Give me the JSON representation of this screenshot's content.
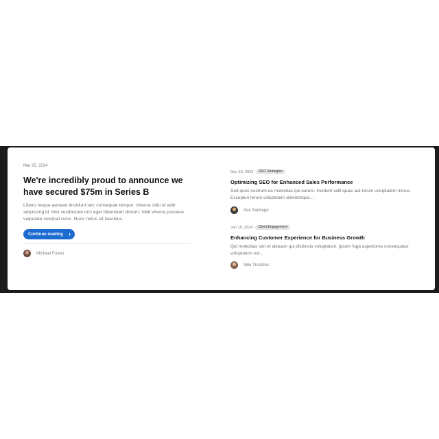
{
  "featured": {
    "date": "Mar 25, 2024",
    "title": "We're incredibly proud to announce we have secured $75m in Series B",
    "excerpt": "Libero neque aenean tincidunt nec consequat tempor. Viverra odio id velit adipiscing id. Nisi vestibulum orci eget bibendum dictum. Velit viverra posuere vulputate volutpat nunc. Nunc netus sit faucibus.",
    "cta_label": "Continue reading",
    "cta_icon": "chevron-right-icon",
    "author": "Michael Foster"
  },
  "posts": [
    {
      "date": "Dec 10, 2023",
      "badge": "SEO Strategies",
      "title": "Optimizing SEO for Enhanced Sales Performance",
      "excerpt": "Sed quos nostrum ea molestias qui earum. Incidunt velit quasi aut rerum voluptatem minus. Excepturi rerum voluptatem doloremque...",
      "author": "Ava Santiago"
    },
    {
      "date": "Jan 15, 2024",
      "badge": "Client Engagement",
      "title": "Enhancing Customer Experience for Business Growth",
      "excerpt": "Qui molestias sint et aliquam qui distinctio voluptatum. Ipsum fuga asperiores consequatur voluptatum est...",
      "author": "Milo Thatcher"
    }
  ],
  "colors": {
    "accent": "#1d6ad1",
    "band": "#1b1b1b",
    "card": "#ffffff",
    "muted_text": "#6f6f6f"
  }
}
